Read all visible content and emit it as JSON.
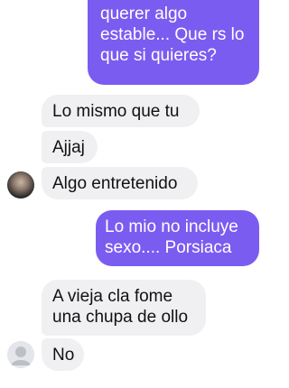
{
  "messages": [
    {
      "id": "b1",
      "side": "sent",
      "text": "querer algo\nestable... Que rs lo\nque si quieres?"
    },
    {
      "id": "b2",
      "side": "received",
      "text": "Lo mismo que tu"
    },
    {
      "id": "b3",
      "side": "received",
      "text": "Ajjaj"
    },
    {
      "id": "b4",
      "side": "received",
      "text": "Algo entretenido"
    },
    {
      "id": "b5",
      "side": "sent",
      "text": "Lo mio no incluye\nsexo.... Porsiaca"
    },
    {
      "id": "b6",
      "side": "received",
      "text": "A vieja cla fome\nuna chupa de ollo"
    },
    {
      "id": "b7",
      "side": "received",
      "text": "No"
    }
  ],
  "colors": {
    "sent_bubble": "#7b5cf0",
    "received_bubble": "#f0f0f3"
  },
  "icons": {
    "contact_avatar": "contact-photo-avatar",
    "default_avatar": "default-user-avatar-icon"
  }
}
